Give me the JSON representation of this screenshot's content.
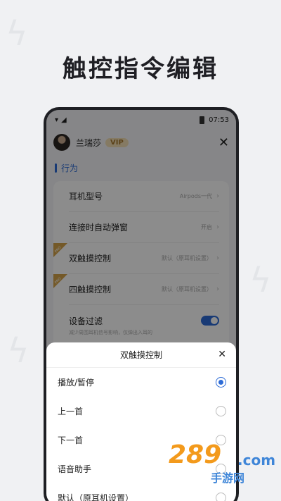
{
  "headline": "触控指令编辑",
  "status_bar": {
    "time": "07:53"
  },
  "profile": {
    "name": "兰瑞莎",
    "badge": "VIP"
  },
  "section_title": "行为",
  "settings": [
    {
      "label": "耳机型号",
      "value": "Airpods一代",
      "pro": false
    },
    {
      "label": "连接时自动弹窗",
      "value": "开启",
      "pro": false
    },
    {
      "label": "双触摸控制",
      "value": "默认（原耳机设置）",
      "pro": true
    },
    {
      "label": "四触摸控制",
      "value": "默认（原耳机设置）",
      "pro": true
    }
  ],
  "filter": {
    "label": "设备过滤",
    "sub": "减少周围耳机信号影响，仅弹出入耳的",
    "enabled": true
  },
  "pro_tag": "PRO",
  "sheet": {
    "title": "双触摸控制",
    "options": [
      {
        "label": "播放/暂停",
        "selected": true
      },
      {
        "label": "上一首",
        "selected": false
      },
      {
        "label": "下一首",
        "selected": false
      },
      {
        "label": "语音助手",
        "selected": false
      },
      {
        "label": "默认（原耳机设置）",
        "selected": false
      }
    ]
  },
  "watermark": {
    "number": "289",
    "domain": ".com",
    "cn": "手游网"
  },
  "colors": {
    "accent": "#2d6bd6",
    "vip_gold": "#d4a24a"
  }
}
